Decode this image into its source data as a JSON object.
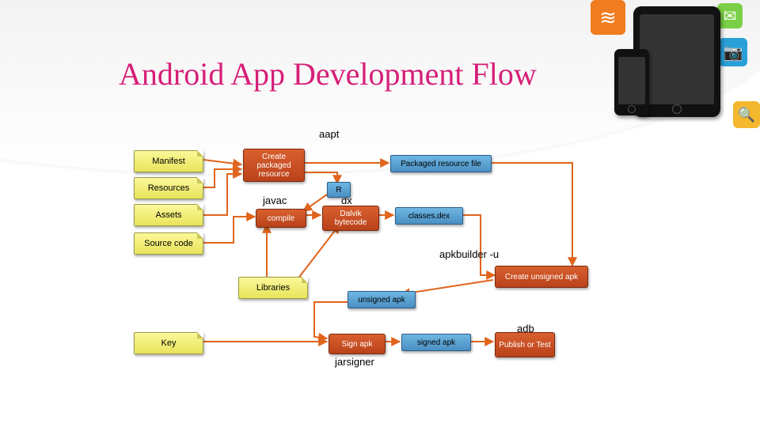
{
  "title": "Android App Development Flow",
  "header_icons": [
    "rss",
    "chat",
    "camera",
    "search",
    "phone",
    "tablet"
  ],
  "tool_labels": {
    "aapt": "aapt",
    "javac": "javac",
    "dx": "dx",
    "apkbuilder": "apkbuilder -u",
    "jarsigner": "jarsigner",
    "adb": "adb"
  },
  "inputs": {
    "manifest": "Manifest",
    "resources": "Resources",
    "assets": "Assets",
    "source": "Source code",
    "libraries": "Libraries",
    "key": "Key"
  },
  "actions": {
    "create_pkg_res": "Create packaged resource",
    "compile": "compile",
    "dalvik": "Dalvik bytecode",
    "create_unsigned": "Create unsigned apk",
    "sign": "Sign apk",
    "publish": "Publish or Test"
  },
  "artifacts": {
    "pkg_res_file": "Packaged resource file",
    "r": "R",
    "classes_dex": "classes.dex",
    "unsigned_apk": "unsigned apk",
    "signed_apk": "signed apk"
  },
  "flow_edges": [
    [
      "manifest",
      "create_pkg_res"
    ],
    [
      "resources",
      "create_pkg_res"
    ],
    [
      "assets",
      "create_pkg_res"
    ],
    [
      "create_pkg_res",
      "pkg_res_file"
    ],
    [
      "create_pkg_res",
      "r"
    ],
    [
      "r",
      "compile"
    ],
    [
      "source",
      "compile"
    ],
    [
      "libraries",
      "compile"
    ],
    [
      "compile",
      "dalvik"
    ],
    [
      "libraries",
      "dalvik"
    ],
    [
      "dalvik",
      "classes_dex"
    ],
    [
      "classes_dex",
      "create_unsigned"
    ],
    [
      "pkg_res_file",
      "create_unsigned"
    ],
    [
      "create_unsigned",
      "unsigned_apk"
    ],
    [
      "unsigned_apk",
      "sign"
    ],
    [
      "key",
      "sign"
    ],
    [
      "sign",
      "signed_apk"
    ],
    [
      "signed_apk",
      "publish"
    ]
  ]
}
